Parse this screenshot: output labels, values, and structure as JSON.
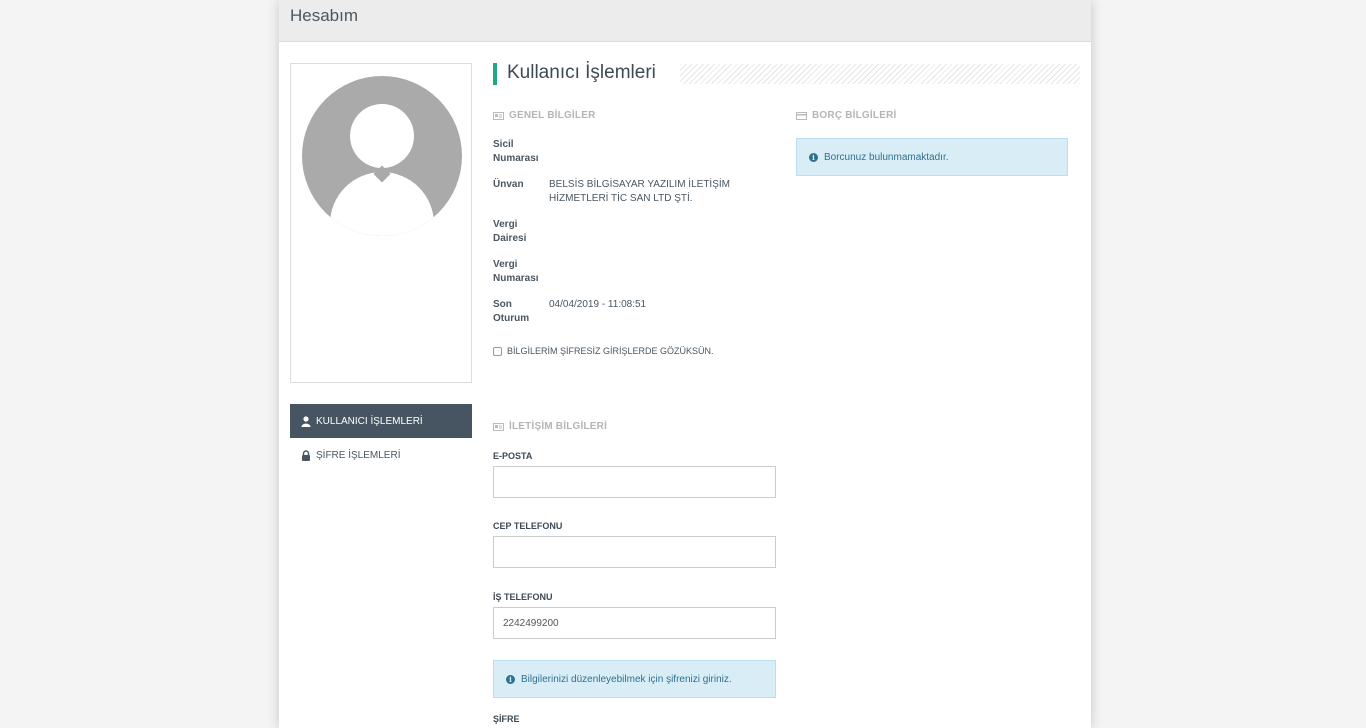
{
  "header": {
    "title": "Hesabım"
  },
  "sidebar": {
    "items": [
      {
        "label": "KULLANICI İŞLEMLERİ",
        "icon": "user-icon",
        "active": true
      },
      {
        "label": "ŞİFRE İŞLEMLERİ",
        "icon": "lock-icon",
        "active": false
      }
    ]
  },
  "main": {
    "heading": "Kullanıcı İşlemleri",
    "general": {
      "title": "GENEL BİLGİLER",
      "rows": [
        {
          "label": "Sicil Numarası",
          "value": ""
        },
        {
          "label": "Ünvan",
          "value": "BELSİS BİLGİSAYAR YAZILIM İLETİŞİM HİZMETLERİ TİC SAN LTD ŞTİ."
        },
        {
          "label": "Vergi Dairesi",
          "value": ""
        },
        {
          "label": "Vergi Numarası",
          "value": ""
        },
        {
          "label": "Son Oturum",
          "value": "04/04/2019 - 11:08:51"
        }
      ],
      "checkbox_label": "BİLGİLERİM ŞİFRESİZ GİRİŞLERDE GÖZÜKSÜN."
    },
    "debt": {
      "title": "BORÇ BİLGİLERİ",
      "message": "Borcunuz bulunmamaktadır."
    },
    "contact": {
      "title": "İLETİŞİM BİLGİLERİ",
      "email_label": "E-POSTA",
      "email_value": "",
      "mobile_label": "CEP TELEFONU",
      "mobile_value": "",
      "work_label": "İŞ TELEFONU",
      "work_value": "2242499200",
      "notice": "Bilgilerinizi düzenleyebilmek için şifrenizi giriniz.",
      "password_label": "ŞİFRE"
    }
  },
  "colors": {
    "accent": "#1fa78a",
    "nav_active": "#465561",
    "info_bg": "#d9edf7"
  }
}
